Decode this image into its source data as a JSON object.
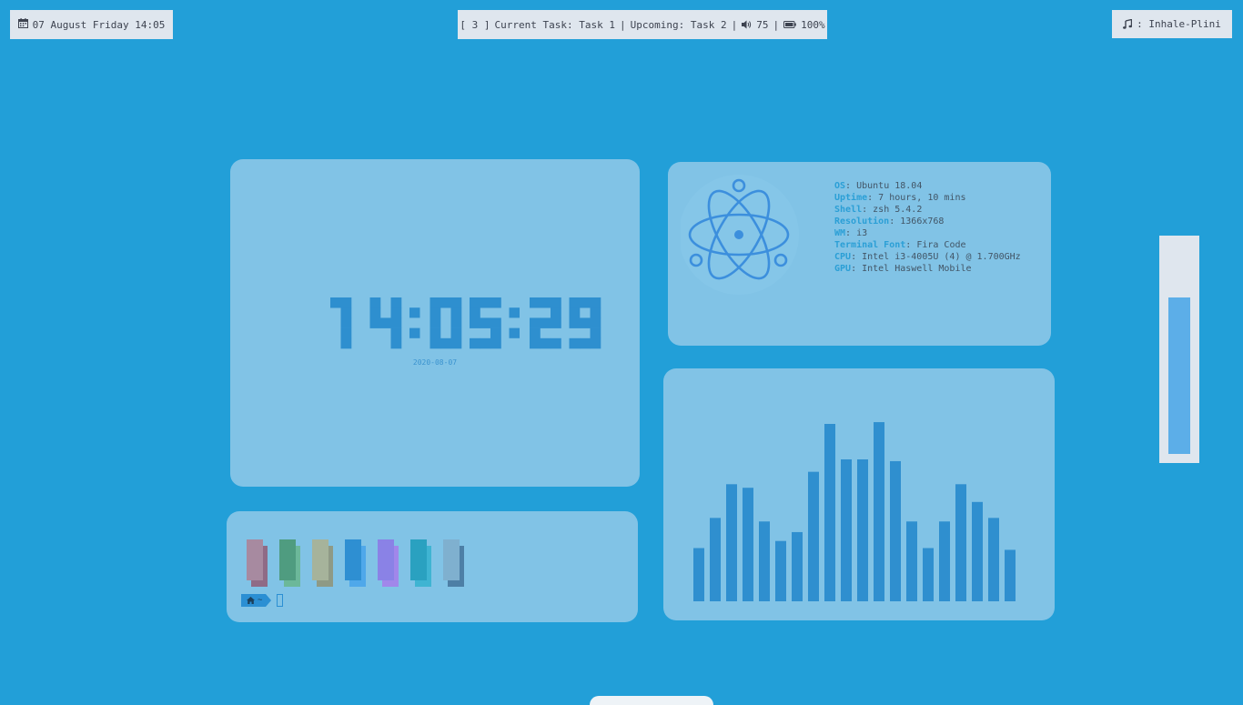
{
  "topbar": {
    "datetime": {
      "icon": "calendar-icon",
      "text": "07 August Friday 14:05"
    },
    "status": {
      "workspace": "[ 3 ]",
      "current_task": "Current Task: Task 1",
      "upcoming_task": "Upcoming: Task 2",
      "separator": "|",
      "volume_icon": "speaker-icon",
      "volume": "75",
      "battery_icon": "battery-icon",
      "battery": "100%"
    },
    "music": {
      "icon": "music-note-icon",
      "text": ": Inhale-Plini"
    }
  },
  "clock": {
    "time": "14:05:29",
    "date": "2020-08-07"
  },
  "sysinfo": {
    "logo_icon": "atom-icon",
    "lines": [
      {
        "key": "OS",
        "value": ": Ubuntu 18.04"
      },
      {
        "key": "Uptime",
        "value": ": 7 hours, 10 mins"
      },
      {
        "key": "Shell",
        "value": ": zsh 5.4.2"
      },
      {
        "key": "Resolution",
        "value": ": 1366x768"
      },
      {
        "key": "WM",
        "value": ": i3"
      },
      {
        "key": "Terminal Font",
        "value": ": Fira Code"
      },
      {
        "key": "CPU",
        "value": ": Intel i3-4005U (4) @ 1.700GHz"
      },
      {
        "key": "GPU",
        "value": ": Intel Haswell Mobile"
      }
    ]
  },
  "terminal": {
    "palette": [
      {
        "normal": "#a78aa0",
        "bright": "#8f6b86"
      },
      {
        "normal": "#4f9c80",
        "bright": "#6cb89a"
      },
      {
        "normal": "#a6b39b",
        "bright": "#8e9a86"
      },
      {
        "normal": "#2e8fd2",
        "bright": "#4fa8ea"
      },
      {
        "normal": "#8a82e6",
        "bright": "#a187ea"
      },
      {
        "normal": "#2aa1c0",
        "bright": "#3fb4d2"
      },
      {
        "normal": "#7fb0cf",
        "bright": "#4d7fa6"
      }
    ],
    "prompt": {
      "home_icon": "home-icon",
      "path": "~"
    }
  },
  "visualizer": {
    "levels": [
      0.3,
      0.47,
      0.66,
      0.64,
      0.45,
      0.34,
      0.39,
      0.73,
      1.0,
      0.8,
      0.8,
      1.01,
      0.79,
      0.45,
      0.3,
      0.45,
      0.66,
      0.56,
      0.47,
      0.29
    ]
  },
  "volume_level": 0.75,
  "colors": {
    "background": "#229fd8",
    "panel": "#81c3e6",
    "accent": "#2b8fd3",
    "clock_digits": "#2e8fcf",
    "bar_fill": "#2f8fcf",
    "pill": "#dfe6ee"
  }
}
